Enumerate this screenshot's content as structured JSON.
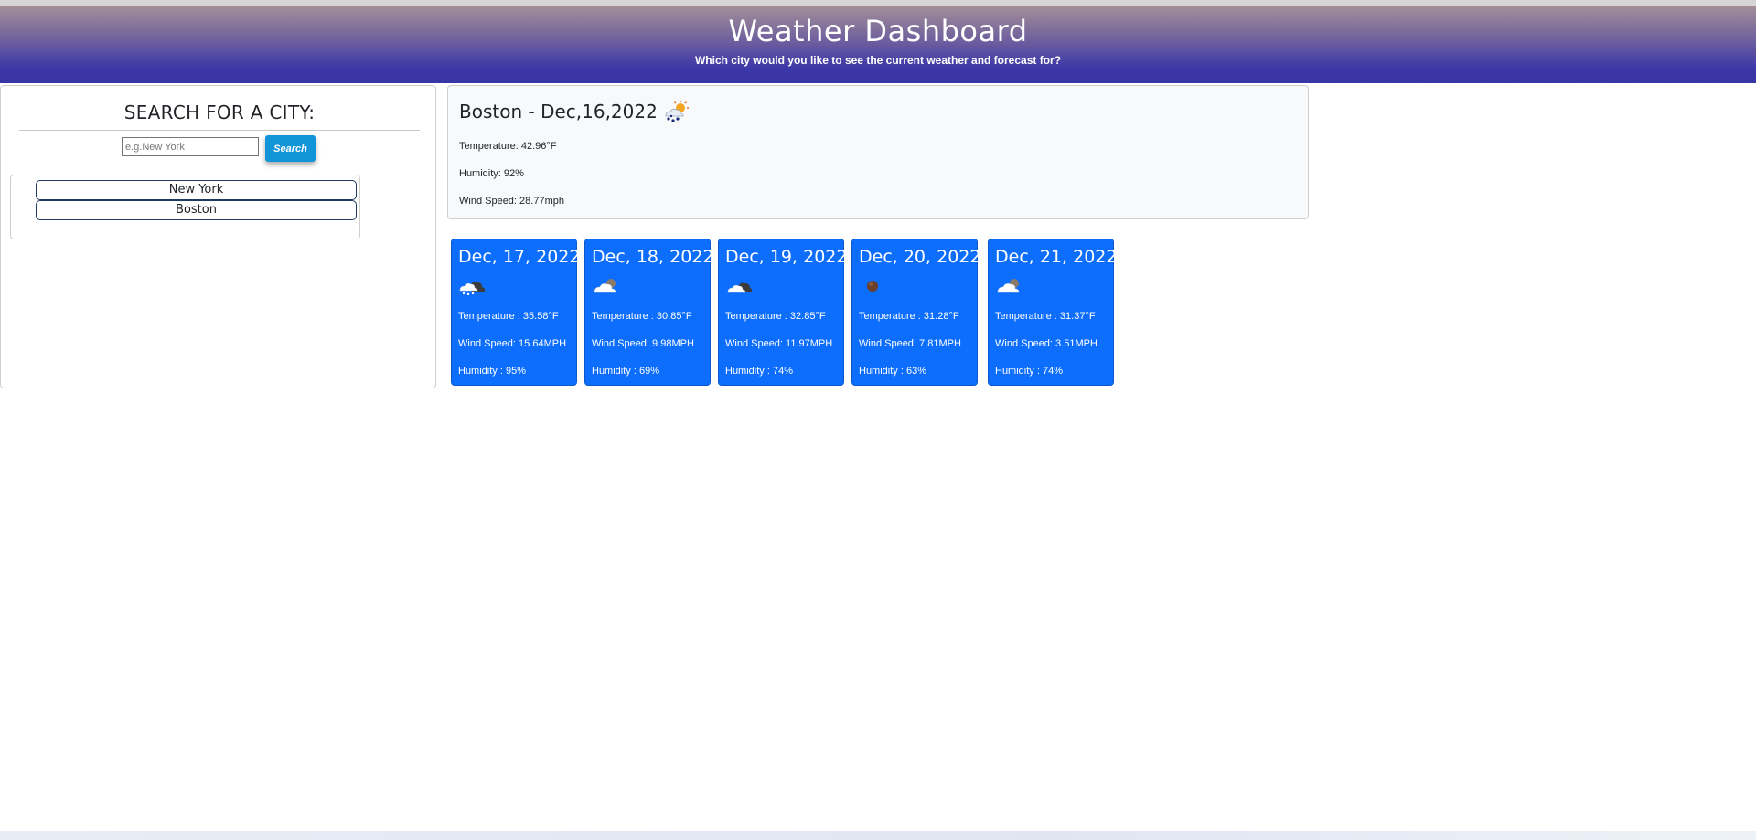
{
  "header": {
    "title": "Weather Dashboard",
    "subtitle": "Which city would you like to see the current weather and forecast for?"
  },
  "search": {
    "heading": "SEARCH FOR A CITY:",
    "placeholder": "e.g.New York",
    "button_label": "Search",
    "history": [
      "New York",
      "Boston"
    ]
  },
  "current": {
    "title": "Boston - Dec,16,2022",
    "icon": "snow-sun-icon",
    "temperature": "Temperature: 42.96°F",
    "humidity": "Humidity: 92%",
    "wind": "Wind Speed: 28.77mph"
  },
  "forecast": [
    {
      "date": "Dec, 17, 2022",
      "icon": "snow-cloud-icon",
      "temperature": "Temperature : 35.58°F",
      "wind": "Wind Speed: 15.64MPH",
      "humidity": "Humidity : 95%"
    },
    {
      "date": "Dec, 18, 2022",
      "icon": "partly-cloudy-icon",
      "temperature": "Temperature : 30.85°F",
      "wind": "Wind Speed: 9.98MPH",
      "humidity": "Humidity : 69%"
    },
    {
      "date": "Dec, 19, 2022",
      "icon": "broken-clouds-icon",
      "temperature": "Temperature : 32.85°F",
      "wind": "Wind Speed: 11.97MPH",
      "humidity": "Humidity : 74%"
    },
    {
      "date": "Dec, 20, 2022",
      "icon": "clear-night-icon",
      "temperature": "Temperature : 31.28°F",
      "wind": "Wind Speed: 7.81MPH",
      "humidity": "Humidity : 63%"
    },
    {
      "date": "Dec, 21, 2022",
      "icon": "partly-cloudy-icon",
      "temperature": "Temperature : 31.37°F",
      "wind": "Wind Speed: 3.51MPH",
      "humidity": "Humidity : 74%"
    }
  ],
  "colors": {
    "card_blue": "#0d6efd",
    "search_button": "#1295d8",
    "header_top": "#a38e98",
    "header_bottom": "#3a35a6"
  }
}
